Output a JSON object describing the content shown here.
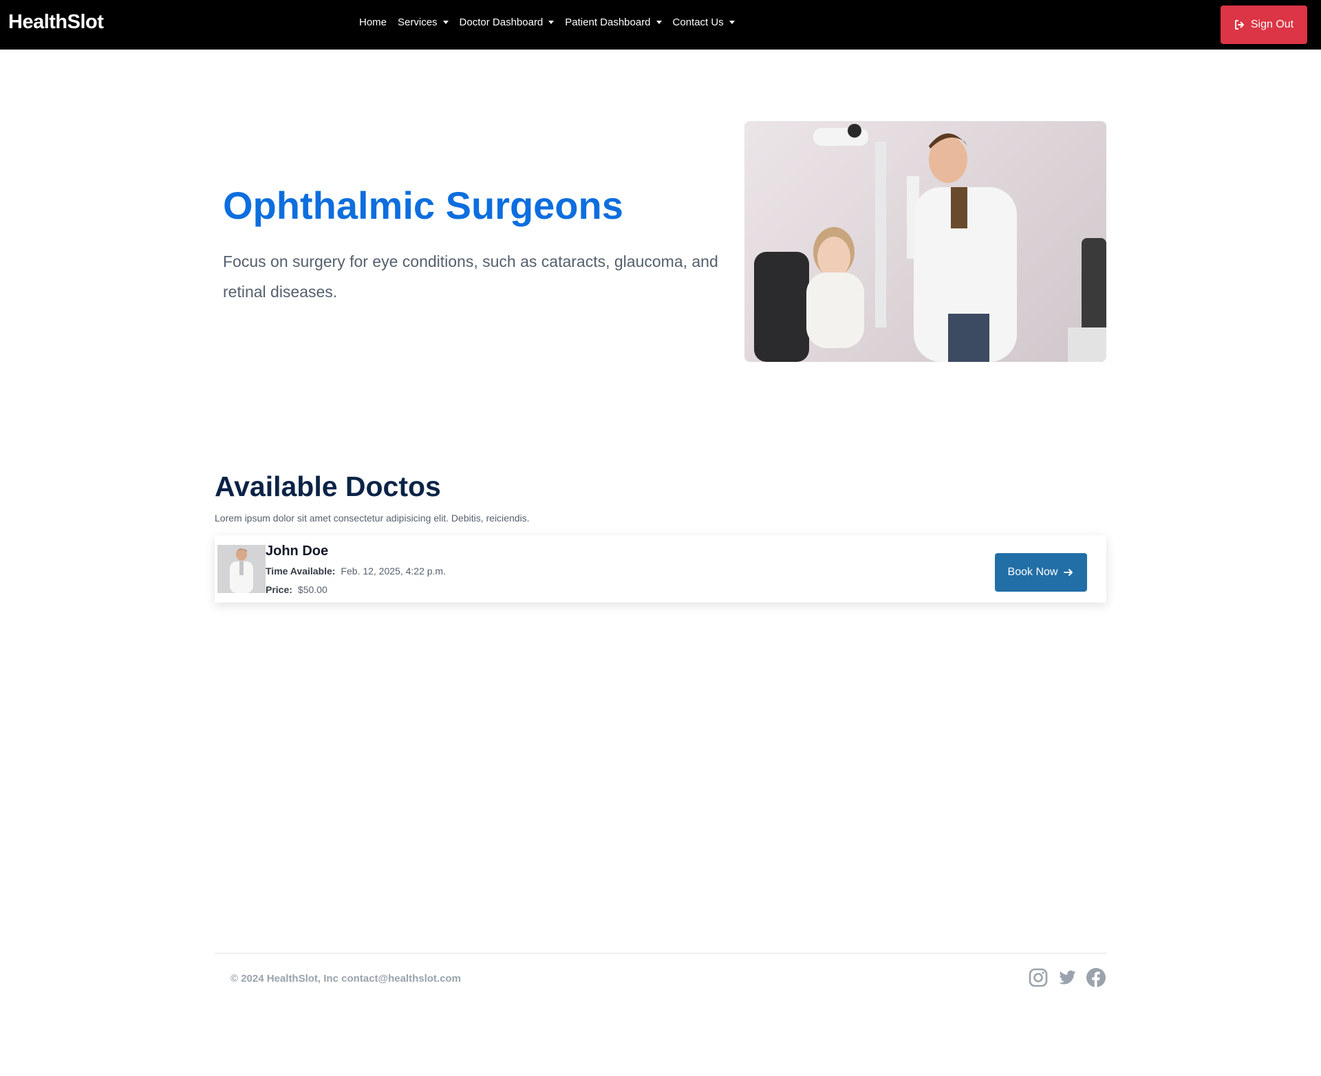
{
  "navbar": {
    "brand": "HealthSlot",
    "links": [
      {
        "label": "Home",
        "dropdown": false
      },
      {
        "label": "Services",
        "dropdown": true
      },
      {
        "label": "Doctor Dashboard",
        "dropdown": true
      },
      {
        "label": "Patient Dashboard",
        "dropdown": true
      },
      {
        "label": "Contact Us",
        "dropdown": true
      }
    ],
    "signout_label": "Sign Out",
    "signout_icon": "sign-out-icon"
  },
  "hero": {
    "title": "Ophthalmic Surgeons",
    "description": "Focus on surgery for eye conditions, such as cataracts, glaucoma, and retinal diseases."
  },
  "doctors_section": {
    "title": "Available Doctos",
    "subtitle": "Lorem ipsum dolor sit amet consectetur adipisicing elit. Debitis, reiciendis.",
    "doctors": [
      {
        "name": "John Doe",
        "time_label": "Time Available:",
        "time_value": "Feb. 12, 2025, 4:22 p.m.",
        "price_label": "Price:",
        "price_value": "$50.00",
        "book_label": "Book Now",
        "book_icon": "arrow-right-icon"
      }
    ]
  },
  "footer": {
    "text": "© 2024 HealthSlot, Inc contact@healthslot.com",
    "social_icons": [
      "instagram-icon",
      "twitter-icon",
      "facebook-icon"
    ]
  },
  "colors": {
    "navbar_bg": "#000000",
    "signout_bg": "#dc3545",
    "hero_title": "#0d6ede",
    "section_title": "#0b2346",
    "book_button": "#226ea7",
    "footer_text": "#9aa3ad"
  }
}
